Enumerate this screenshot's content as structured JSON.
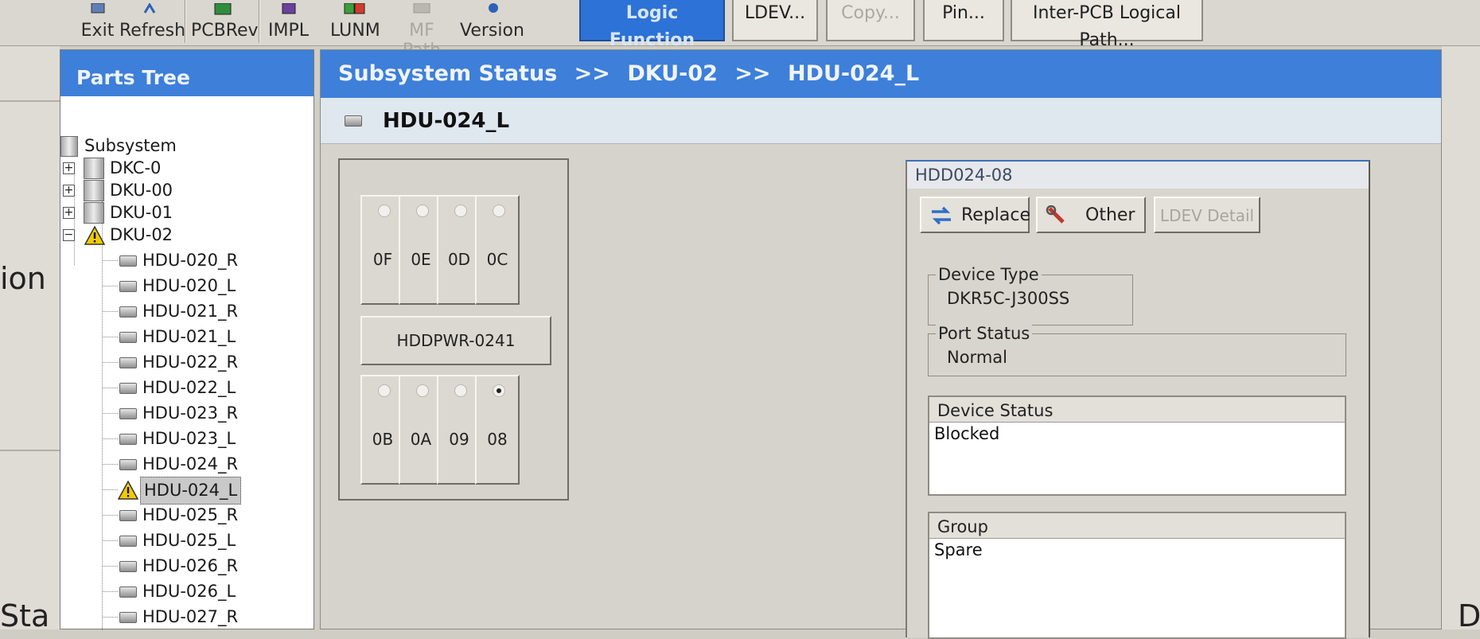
{
  "toolbar": {
    "buttons": [
      {
        "label": "Exit",
        "icon": "exit-icon"
      },
      {
        "label": "Refresh",
        "icon": "refresh-icon"
      },
      {
        "label": "PCBRev",
        "icon": "pcb-icon"
      },
      {
        "label": "IMPL",
        "icon": "chip-icon"
      },
      {
        "label": "LUNM",
        "icon": "lun-icon"
      },
      {
        "label": "MF Path",
        "icon": "path-icon",
        "disabled": true
      },
      {
        "label": "Version",
        "icon": "info-icon"
      }
    ],
    "tabs": [
      {
        "label": "Logic Function",
        "active": true
      },
      {
        "label": "LDEV..."
      },
      {
        "label": "Copy...",
        "disabled": true
      },
      {
        "label": "Pin..."
      },
      {
        "label": "Inter-PCB Logical Path..."
      }
    ]
  },
  "tree": {
    "title": "Parts Tree",
    "root": "Subsystem",
    "nodes": [
      {
        "label": "DKC-0"
      },
      {
        "label": "DKU-00"
      },
      {
        "label": "DKU-01"
      },
      {
        "label": "DKU-02",
        "warning": true,
        "expanded": true
      }
    ],
    "children": [
      {
        "label": "HDU-020_R"
      },
      {
        "label": "HDU-020_L"
      },
      {
        "label": "HDU-021_R"
      },
      {
        "label": "HDU-021_L"
      },
      {
        "label": "HDU-022_R"
      },
      {
        "label": "HDU-022_L"
      },
      {
        "label": "HDU-023_R"
      },
      {
        "label": "HDU-023_L"
      },
      {
        "label": "HDU-024_R"
      },
      {
        "label": "HDU-024_L",
        "warning": true,
        "selected": true
      },
      {
        "label": "HDU-025_R"
      },
      {
        "label": "HDU-025_L"
      },
      {
        "label": "HDU-026_R"
      },
      {
        "label": "HDU-026_L"
      },
      {
        "label": "HDU-027_R"
      }
    ]
  },
  "breadcrumb": {
    "parts": [
      "Subsystem Status",
      ">>",
      "DKU-02",
      ">>",
      "HDU-024_L"
    ]
  },
  "hdu": {
    "title": "HDU-024_L",
    "top_slots": [
      "0F",
      "0E",
      "0D",
      "0C"
    ],
    "power": "HDDPWR-0241",
    "bottom_slots": [
      "0B",
      "0A",
      "09",
      "08"
    ],
    "selected_slot": "08"
  },
  "detail": {
    "title": "HDD024-08",
    "buttons": {
      "replace": "Replace",
      "other": "Other",
      "ldev_detail": "LDEV Detail"
    },
    "device_type_label": "Device Type",
    "device_type_value": "DKR5C-J300SS",
    "port_status_label": "Port Status",
    "port_status_value": "Normal",
    "device_status_label": "Device Status",
    "device_status_value": "Blocked",
    "group_label": "Group",
    "group_value": "Spare"
  },
  "background": {
    "left_fragment_1": "ion",
    "left_fragment_2": "Sta",
    "right_fragment": "D"
  },
  "colors": {
    "accent_blue": "#3d7fd9",
    "active_tab": "#2d72d6",
    "warning": "#f2cc00",
    "panel_gray": "#d5d3cb"
  }
}
